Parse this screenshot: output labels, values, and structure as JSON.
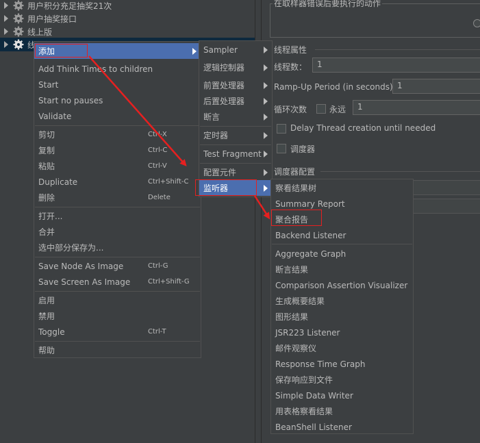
{
  "tree": {
    "items": [
      {
        "label": "用户积分充足抽奖21次"
      },
      {
        "label": "用户抽奖接口"
      },
      {
        "label": "线上版"
      },
      {
        "label": "线程组"
      }
    ]
  },
  "panel": {
    "error_action_title": "在取样器错误后要执行的动作",
    "thread_props_title": "线程属性",
    "threads_label": "线程数：",
    "threads_value": "1",
    "rampup_label": "Ramp-Up Period (in seconds):",
    "rampup_value": "1",
    "loop_label": "循环次数",
    "forever_label": "永远",
    "loop_value": "1",
    "delay_label": "Delay Thread creation until needed",
    "scheduler_label": "调度器",
    "scheduler_config_title": "调度器配置"
  },
  "menu1": {
    "items": [
      {
        "label": "添加",
        "shortcut": "",
        "sub": true
      },
      {
        "label": "Add Think Times to children",
        "shortcut": ""
      },
      {
        "label": "Start",
        "shortcut": ""
      },
      {
        "label": "Start no pauses",
        "shortcut": ""
      },
      {
        "label": "Validate",
        "shortcut": ""
      },
      {
        "label": "剪切",
        "shortcut": "Ctrl-X"
      },
      {
        "label": "复制",
        "shortcut": "Ctrl-C"
      },
      {
        "label": "粘贴",
        "shortcut": "Ctrl-V"
      },
      {
        "label": "Duplicate",
        "shortcut": "Ctrl+Shift-C"
      },
      {
        "label": "删除",
        "shortcut": "Delete"
      },
      {
        "label": "打开...",
        "shortcut": ""
      },
      {
        "label": "合并",
        "shortcut": ""
      },
      {
        "label": "选中部分保存为...",
        "shortcut": ""
      },
      {
        "label": "Save Node As Image",
        "shortcut": "Ctrl-G"
      },
      {
        "label": "Save Screen As Image",
        "shortcut": "Ctrl+Shift-G"
      },
      {
        "label": "启用",
        "shortcut": ""
      },
      {
        "label": "禁用",
        "shortcut": ""
      },
      {
        "label": "Toggle",
        "shortcut": "Ctrl-T"
      },
      {
        "label": "帮助",
        "shortcut": ""
      }
    ]
  },
  "menu2": {
    "items": [
      {
        "label": "Sampler"
      },
      {
        "label": "逻辑控制器"
      },
      {
        "label": "前置处理器"
      },
      {
        "label": "后置处理器"
      },
      {
        "label": "断言"
      },
      {
        "label": "定时器"
      },
      {
        "label": "Test Fragment"
      },
      {
        "label": "配置元件"
      },
      {
        "label": "监听器"
      }
    ]
  },
  "menu3": {
    "items": [
      {
        "label": "察看结果树"
      },
      {
        "label": "Summary Report"
      },
      {
        "label": "聚合报告"
      },
      {
        "label": "Backend Listener"
      },
      {
        "label": "Aggregate Graph"
      },
      {
        "label": "断言结果"
      },
      {
        "label": "Comparison Assertion Visualizer"
      },
      {
        "label": "生成概要结果"
      },
      {
        "label": "图形结果"
      },
      {
        "label": "JSR223 Listener"
      },
      {
        "label": "邮件观察仪"
      },
      {
        "label": "Response Time Graph"
      },
      {
        "label": "保存响应到文件"
      },
      {
        "label": "Simple Data Writer"
      },
      {
        "label": "用表格察看结果"
      },
      {
        "label": "BeanShell Listener"
      }
    ]
  },
  "colors": {
    "highlight": "#4b6eaf",
    "annotation": "#e62020",
    "background": "#3c3f41"
  }
}
